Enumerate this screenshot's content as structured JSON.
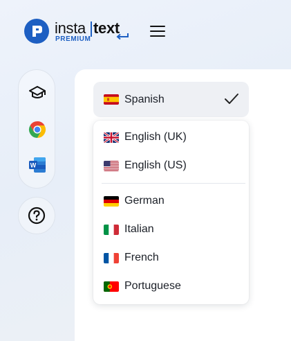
{
  "brand": {
    "word1": "insta",
    "word2": "text",
    "tier": "PREMIUM",
    "accent": "#1d5fc2"
  },
  "toolbar": {
    "menu_icon": "hamburger-menu-icon",
    "tools": [
      {
        "icon": "graduation-cap-icon"
      },
      {
        "icon": "chrome-icon"
      },
      {
        "icon": "word-icon"
      }
    ],
    "help_icon": "help-circle-icon"
  },
  "language_select": {
    "selected": {
      "label": "Spanish",
      "flag": "es",
      "check_icon": "checkmark-icon"
    },
    "options_group1": [
      {
        "label": "English (UK)",
        "flag": "gb"
      },
      {
        "label": "English (US)",
        "flag": "us"
      }
    ],
    "options_group2": [
      {
        "label": "German",
        "flag": "de"
      },
      {
        "label": "Italian",
        "flag": "it"
      },
      {
        "label": "French",
        "flag": "fr"
      },
      {
        "label": "Portuguese",
        "flag": "pt"
      }
    ]
  }
}
